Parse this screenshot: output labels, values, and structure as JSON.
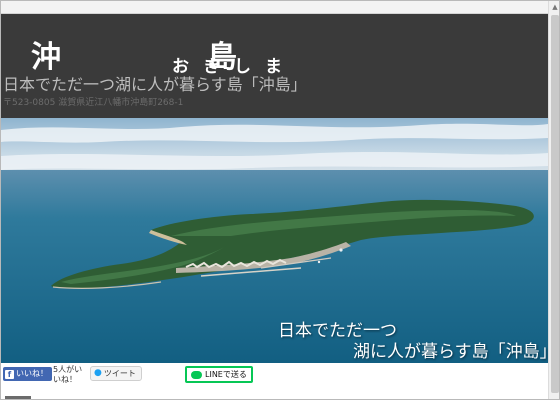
{
  "header": {
    "title": "沖　島",
    "kana": "おきしま",
    "tagline": "日本でただ一つ湖に人が暮らす島「沖島」",
    "address": "〒523-0805 滋賀県近江八幡市沖島町268-1"
  },
  "hero": {
    "line1": "日本でただ一つ",
    "line2": "湖に人が暮らす島「沖島」"
  },
  "social": {
    "fb_label": "いいね！",
    "fb_icon": "f",
    "fb_count": "5人がいいね！",
    "tweet_label": "ツイート",
    "line_label": "LINEで送る"
  },
  "colors": {
    "header_bg": "#3a3a3a",
    "lake": "#1c6b8e",
    "facebook": "#4267b2",
    "line": "#06c755"
  }
}
